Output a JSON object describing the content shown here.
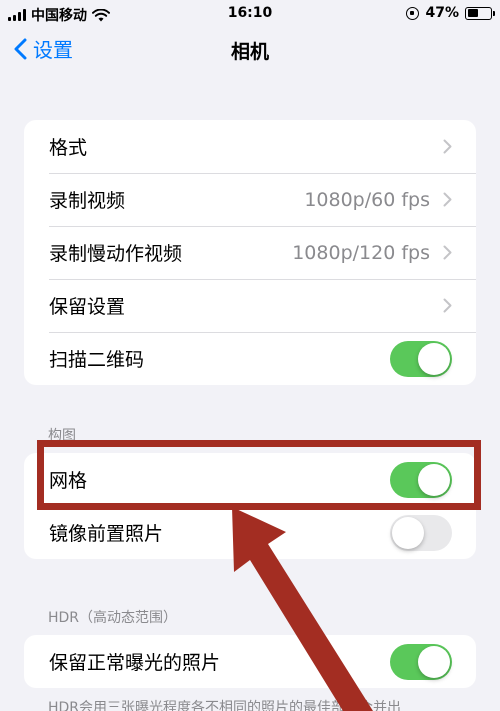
{
  "status_bar": {
    "carrier": "中国移动",
    "time": "16:10",
    "battery_percent": "47%",
    "battery_level": 0.47,
    "icons": [
      "signal-bars-icon",
      "wifi-icon",
      "rotation-lock-icon",
      "battery-icon"
    ]
  },
  "nav": {
    "back_label": "设置",
    "title": "相机"
  },
  "group1": {
    "rows": [
      {
        "label": "格式",
        "value": "",
        "control": "chevron"
      },
      {
        "label": "录制视频",
        "value": "1080p/60 fps",
        "control": "chevron"
      },
      {
        "label": "录制慢动作视频",
        "value": "1080p/120 fps",
        "control": "chevron"
      },
      {
        "label": "保留设置",
        "value": "",
        "control": "chevron"
      },
      {
        "label": "扫描二维码",
        "value": "",
        "control": "toggle",
        "on": true
      }
    ]
  },
  "composition": {
    "header": "构图",
    "rows": [
      {
        "label": "网格",
        "control": "toggle",
        "on": true
      },
      {
        "label": "镜像前置照片",
        "control": "toggle",
        "on": false
      }
    ]
  },
  "hdr": {
    "header": "HDR（高动态范围）",
    "rows": [
      {
        "label": "保留正常曝光的照片",
        "control": "toggle",
        "on": true
      }
    ],
    "footer": "HDR会用三张曝光程度各不相同的照片的最佳部分合并出"
  },
  "colors": {
    "accent": "#007aff",
    "toggle_on": "#5ac85a",
    "toggle_off": "#e9e9eb",
    "annotation": "#a32d22",
    "background": "#f2f2f7"
  }
}
